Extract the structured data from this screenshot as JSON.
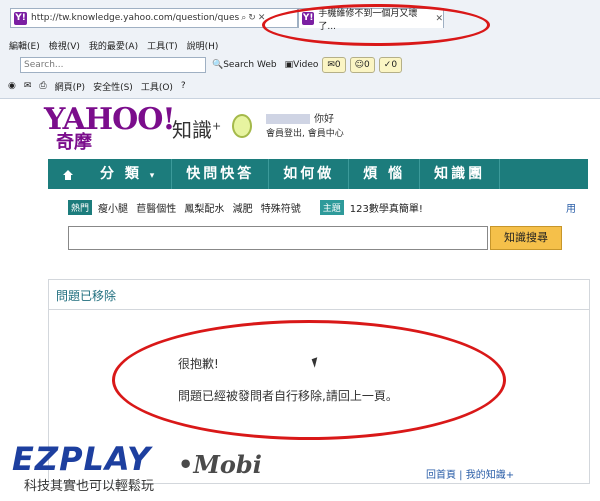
{
  "browser": {
    "address": "http://tw.knowledge.yahoo.com/question/ques",
    "tab_title": "手機維修不到一個月又壞了...",
    "menu": [
      "編輯(E)",
      "檢視(V)",
      "我的最愛(A)",
      "工具(T)",
      "說明(H)"
    ],
    "search_placeholder": "Search...",
    "search_web": "Search Web",
    "video": "Video",
    "badges": [
      "0",
      "0",
      "0"
    ],
    "commands": [
      "網頁(P)",
      "安全性(S)",
      "工具(O)"
    ]
  },
  "site": {
    "logo": "YAHOO!",
    "logo_sub": "奇摩",
    "brand": "知識",
    "brand_plus": "+",
    "greeting": "你好",
    "user_links": "會員登出, 會員中心",
    "nav": [
      "分 類",
      "快問快答",
      "如何做",
      "煩 惱",
      "知識團"
    ],
    "hot_label": "熱門",
    "hot_links": [
      "瘦小腿",
      "苣醫個性",
      "鳳梨配水",
      "減肥",
      "特殊符號"
    ],
    "topic_label": "主題",
    "topic_text": "123數學真簡單!",
    "search_button": "知識搜尋",
    "right_cut": "用"
  },
  "panel": {
    "title": "問題已移除",
    "sorry": "很抱歉!",
    "message": "問題已經被發問者自行移除,請回上一頁。",
    "footer": "回首頁 | 我的知識+"
  },
  "watermark": {
    "ez": "EZPLAY",
    "mobi": "•Mobi",
    "slogan": "科技其實也可以輕鬆玩"
  }
}
